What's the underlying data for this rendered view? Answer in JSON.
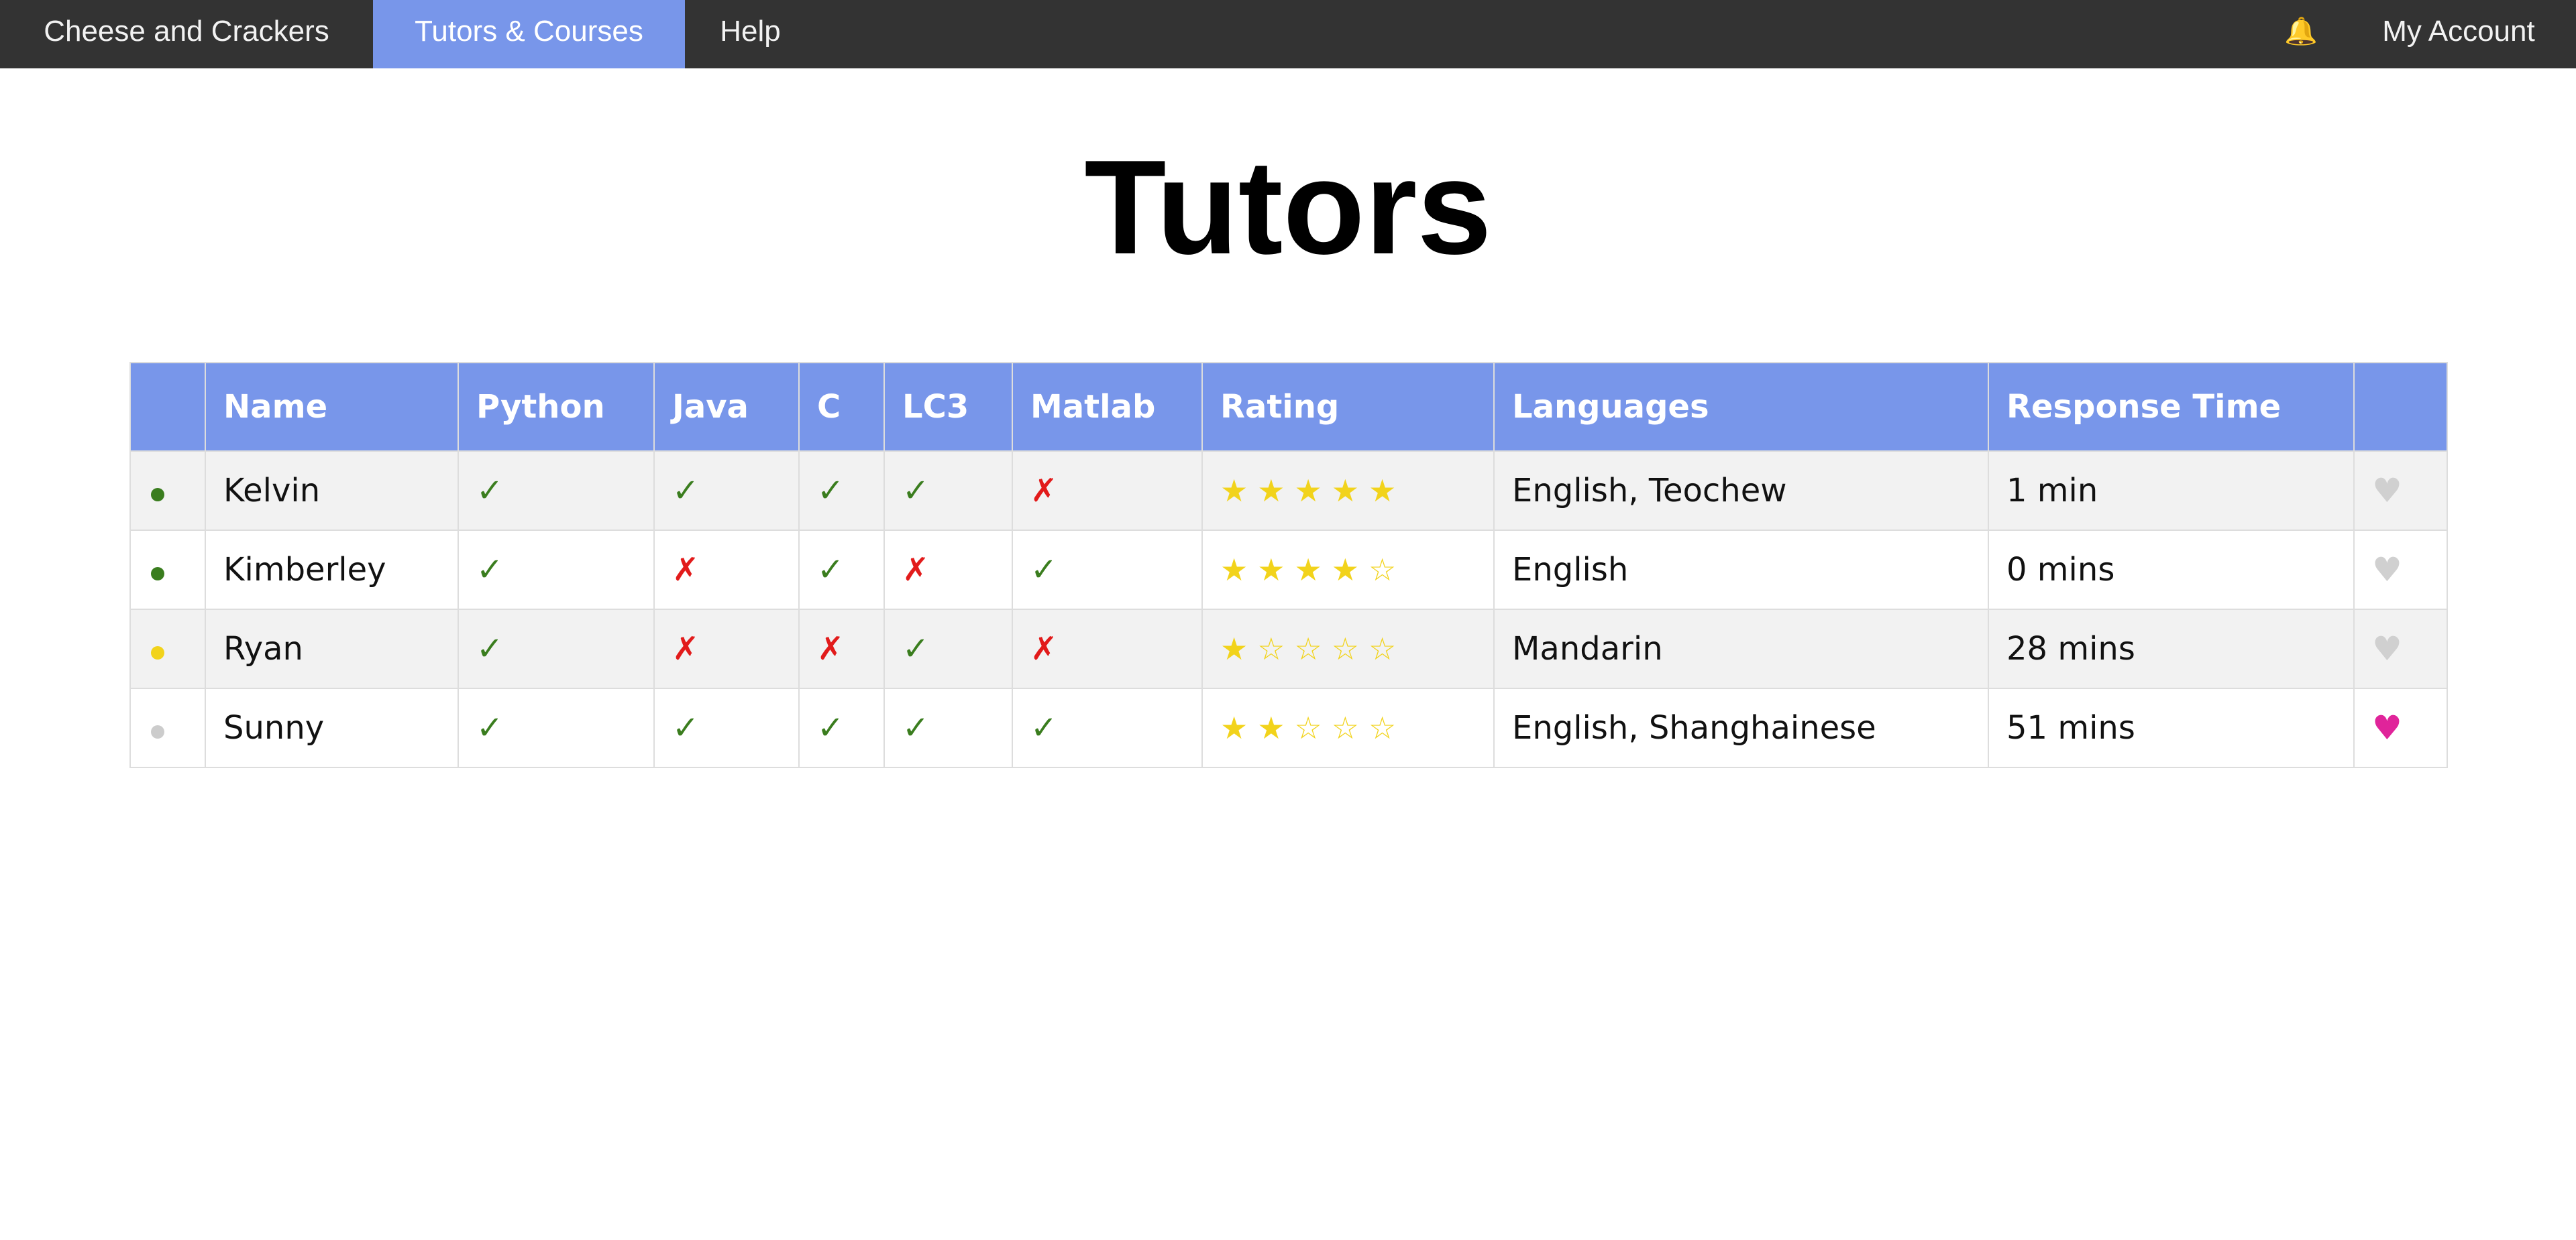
{
  "nav": {
    "brand": "Cheese and Crackers",
    "tutors_courses": "Tutors & Courses",
    "help": "Help",
    "bell_icon": "🔔",
    "account": "My Account"
  },
  "page": {
    "title": "Tutors"
  },
  "table": {
    "headers": [
      "",
      "Name",
      "Python",
      "Java",
      "C",
      "LC3",
      "Matlab",
      "Rating",
      "Languages",
      "Response Time",
      ""
    ],
    "rows": [
      {
        "status_color": "#3a7d1e",
        "name": "Kelvin",
        "skills": [
          "✓",
          "✓",
          "✓",
          "✓",
          "✗"
        ],
        "rating": 5,
        "rating_stars": "★★★★★",
        "languages": "English, Teochew",
        "response_time": "1 min",
        "favorite": false,
        "heart": "♥"
      },
      {
        "status_color": "#3a7d1e",
        "name": "Kimberley",
        "skills": [
          "✓",
          "✗",
          "✓",
          "✗",
          "✓"
        ],
        "rating": 4,
        "rating_stars": "★★★★☆",
        "languages": "English",
        "response_time": "0 mins",
        "favorite": false,
        "heart": "♥"
      },
      {
        "status_color": "#f2d31b",
        "name": "Ryan",
        "skills": [
          "✓",
          "✗",
          "✗",
          "✓",
          "✗"
        ],
        "rating": 1,
        "rating_stars": "★☆☆☆☆",
        "languages": "Mandarin",
        "response_time": "28 mins",
        "favorite": false,
        "heart": "♥"
      },
      {
        "status_color": "#cccccc",
        "name": "Sunny",
        "skills": [
          "✓",
          "✓",
          "✓",
          "✓",
          "✓"
        ],
        "rating": 2,
        "rating_stars": "★★☆☆☆",
        "languages": "English, Shanghainese",
        "response_time": "51 mins",
        "favorite": true,
        "heart": "♥"
      }
    ]
  },
  "colors": {
    "nav_bg": "#333333",
    "accent": "#7896ea",
    "yes": "#3a7d1e",
    "no": "#e21b1b",
    "star": "#f2d31b",
    "heart_off": "#d0d0d0",
    "heart_on": "#e0249a"
  }
}
